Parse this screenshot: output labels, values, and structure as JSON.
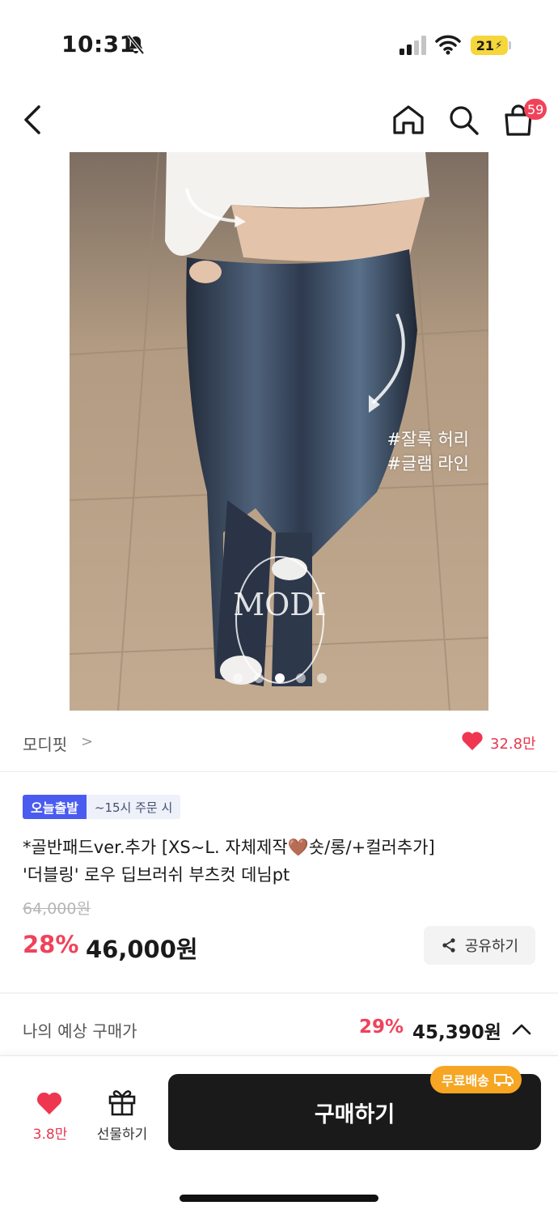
{
  "status_bar": {
    "time": "10:31",
    "battery": "21"
  },
  "nav": {
    "icons": [
      "back-icon",
      "home-icon",
      "search-icon",
      "bag-icon"
    ],
    "cart_badge": "59"
  },
  "gallery": {
    "caption_line1": "#잘록 허리",
    "caption_line2": "#글램 라인",
    "watermark": "MODI",
    "slide_count": 5,
    "active_slide": 3
  },
  "shop": {
    "name": "모디핏",
    "chevron": ">",
    "likes": "32.8만"
  },
  "product": {
    "badge_today": "오늘출발",
    "badge_order": "~15시 주문 시",
    "title_line1": "*골반패드ver.추가 [XS~L. 자체제작🤎숏/롱/+컬러추가]",
    "title_line2": "'더블링' 로우 딥브러쉬 부츠컷 데님pt",
    "original_price": "64,000원",
    "discount": "28%",
    "price": "46,000원",
    "share_label": "공유하기"
  },
  "estimate": {
    "label": "나의 예상 구매가",
    "discount": "29%",
    "price": "45,390원"
  },
  "bottom_bar": {
    "wish_count": "3.8만",
    "gift_label": "선물하기",
    "buy_label": "구매하기",
    "free_shipping": "무료배송"
  },
  "colors": {
    "accent_red": "#f0425a",
    "badge_blue": "#4a5cf0",
    "shipping_orange": "#f6a623",
    "buy_button": "#1a1a1a"
  }
}
